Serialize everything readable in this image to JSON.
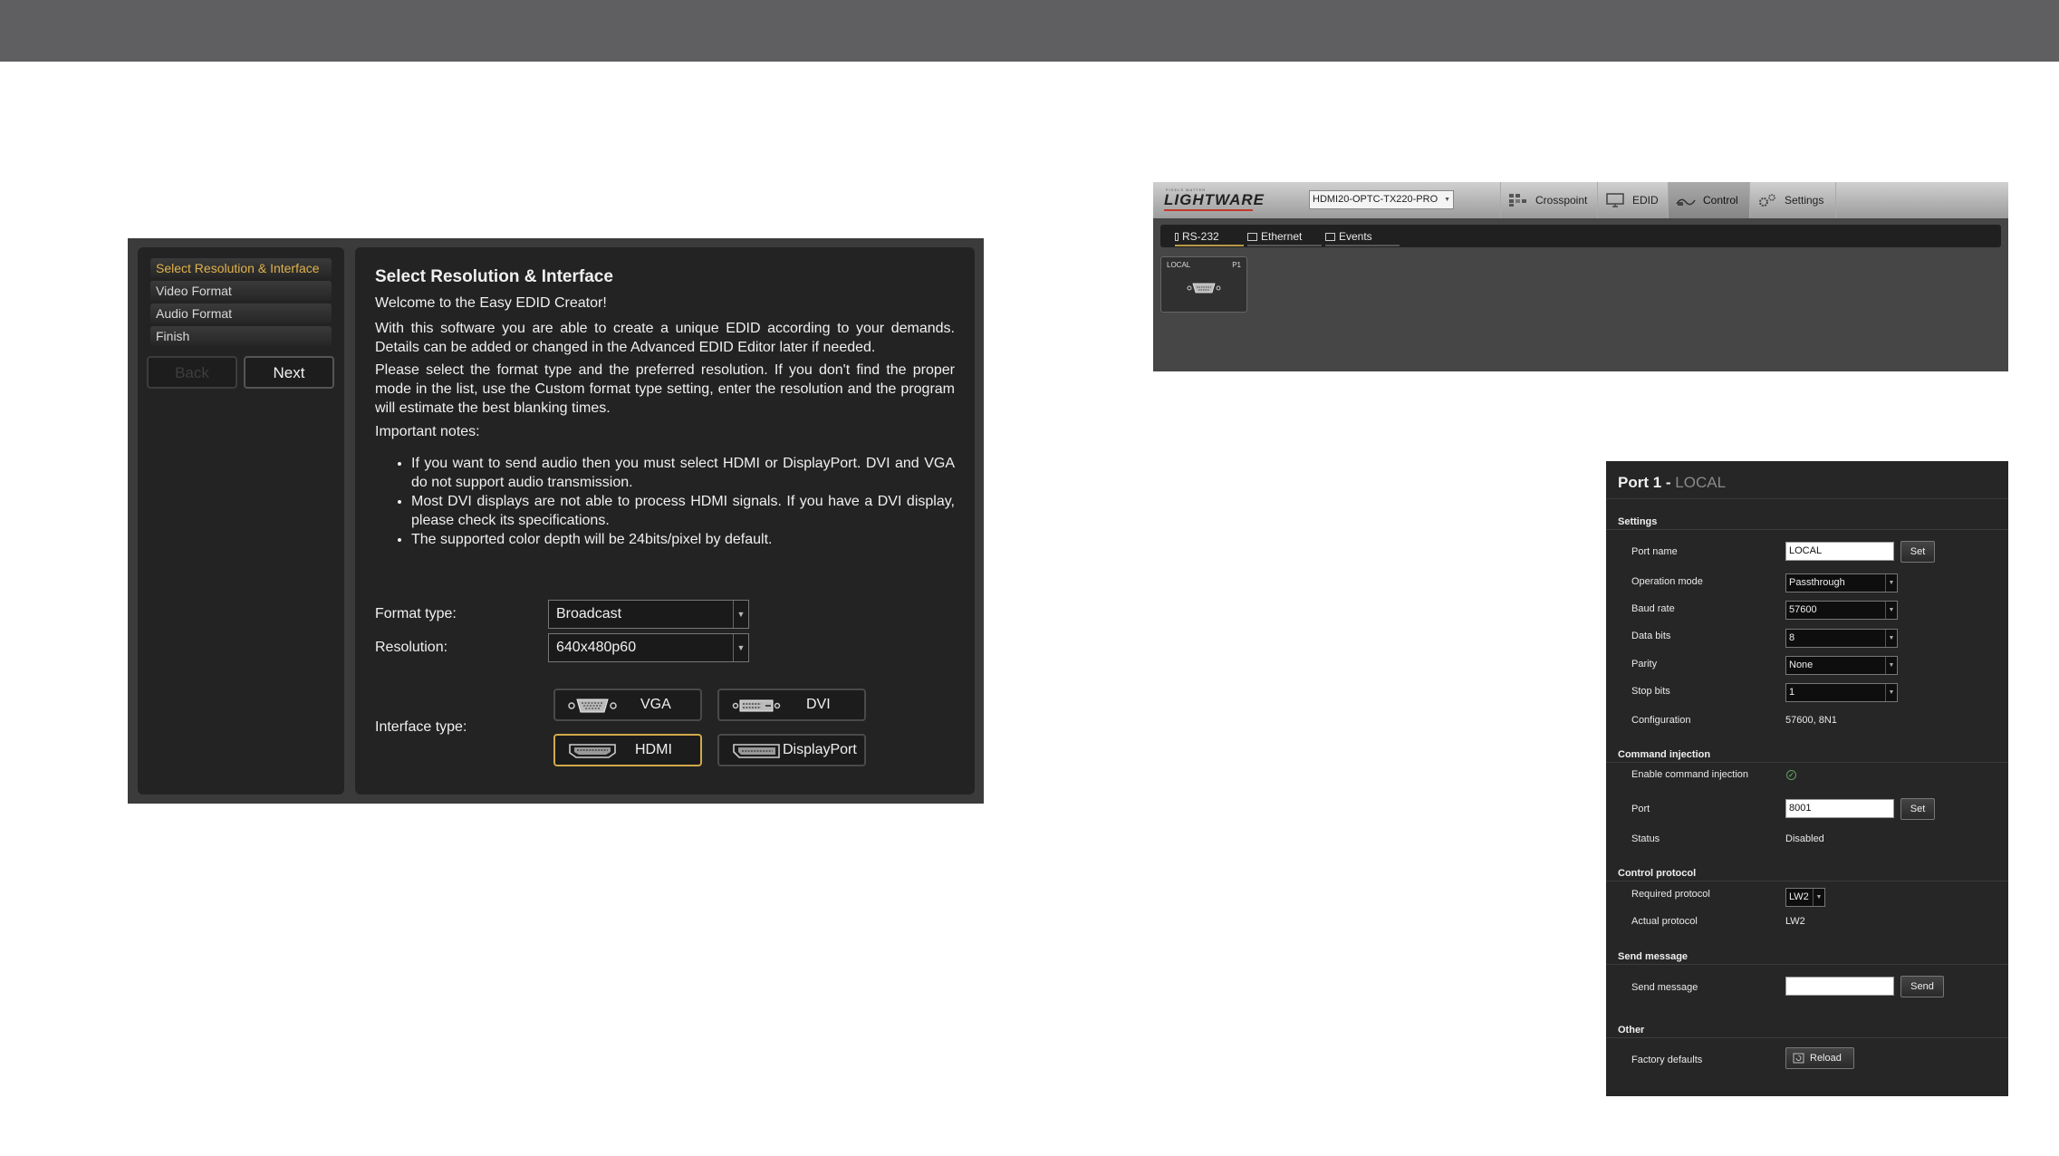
{
  "wizard": {
    "steps": [
      {
        "label": "Select Resolution & Interface"
      },
      {
        "label": "Video Format"
      },
      {
        "label": "Audio Format"
      },
      {
        "label": "Finish"
      }
    ],
    "back_label": "Back",
    "next_label": "Next",
    "title": "Select Resolution & Interface",
    "welcome": "Welcome to the Easy EDID Creator!",
    "intro": "With this software you are able to create a unique EDID according to your demands. Details can be added or changed in the Advanced EDID Editor later if needed.",
    "instructions": "Please select the format type and the preferred resolution. If you don't find the proper mode in the list, use the Custom format type setting, enter the resolution and the program will estimate the best blanking times.",
    "notes_heading": "Important notes:",
    "notes": [
      "If you want to send audio then you must select HDMI or DisplayPort. DVI and VGA do not support audio transmission.",
      "Most DVI displays are not able to process HDMI signals. If you have a DVI display, please check its specifications.",
      "The supported color depth will be 24bits/pixel by default."
    ],
    "format_type_label": "Format type:",
    "format_type_value": "Broadcast",
    "resolution_label": "Resolution:",
    "resolution_value": "640x480p60",
    "interface_type_label": "Interface type:",
    "interfaces": {
      "vga": "VGA",
      "dvi": "DVI",
      "hdmi": "HDMI",
      "displayport": "DisplayPort"
    },
    "selected_interface": "HDMI",
    "accent_color": "#d2a94b"
  },
  "lightware": {
    "logo_tagline": "PIXELS MATTER",
    "logo": "LIGHTWARE",
    "device": "HDMI20-OPTC-TX220-PRO",
    "tabs": [
      {
        "label": "Crosspoint",
        "icon": "crosspoint-icon"
      },
      {
        "label": "EDID",
        "icon": "monitor-icon"
      },
      {
        "label": "Control",
        "icon": "control-icon"
      },
      {
        "label": "Settings",
        "icon": "gear-icon"
      }
    ],
    "active_tab": "Control",
    "subtabs": [
      {
        "label": "RS-232"
      },
      {
        "label": "Ethernet"
      },
      {
        "label": "Events"
      }
    ],
    "port_tile": {
      "name": "LOCAL",
      "id": "P1"
    }
  },
  "port_panel": {
    "title": "Port 1 - ",
    "title_sub": "LOCAL",
    "settings_heading": "Settings",
    "port_name_label": "Port name",
    "port_name_value": "LOCAL",
    "set_label": "Set",
    "operation_mode_label": "Operation mode",
    "operation_mode_value": "Passthrough",
    "baud_rate_label": "Baud rate",
    "baud_rate_value": "57600",
    "data_bits_label": "Data bits",
    "data_bits_value": "8",
    "parity_label": "Parity",
    "parity_value": "None",
    "stop_bits_label": "Stop bits",
    "stop_bits_value": "1",
    "configuration_label": "Configuration",
    "configuration_value": "57600, 8N1",
    "command_injection_heading": "Command injection",
    "enable_injection_label": "Enable command injection",
    "port_label": "Port",
    "port_value": "8001",
    "status_label": "Status",
    "status_value": "Disabled",
    "control_protocol_heading": "Control protocol",
    "required_protocol_label": "Required protocol",
    "required_protocol_value": "LW2",
    "actual_protocol_label": "Actual protocol",
    "actual_protocol_value": "LW2",
    "send_message_heading": "Send message",
    "send_message_label": "Send message",
    "send_message_value": "",
    "send_label": "Send",
    "other_heading": "Other",
    "factory_defaults_label": "Factory defaults",
    "reload_label": "Reload"
  }
}
